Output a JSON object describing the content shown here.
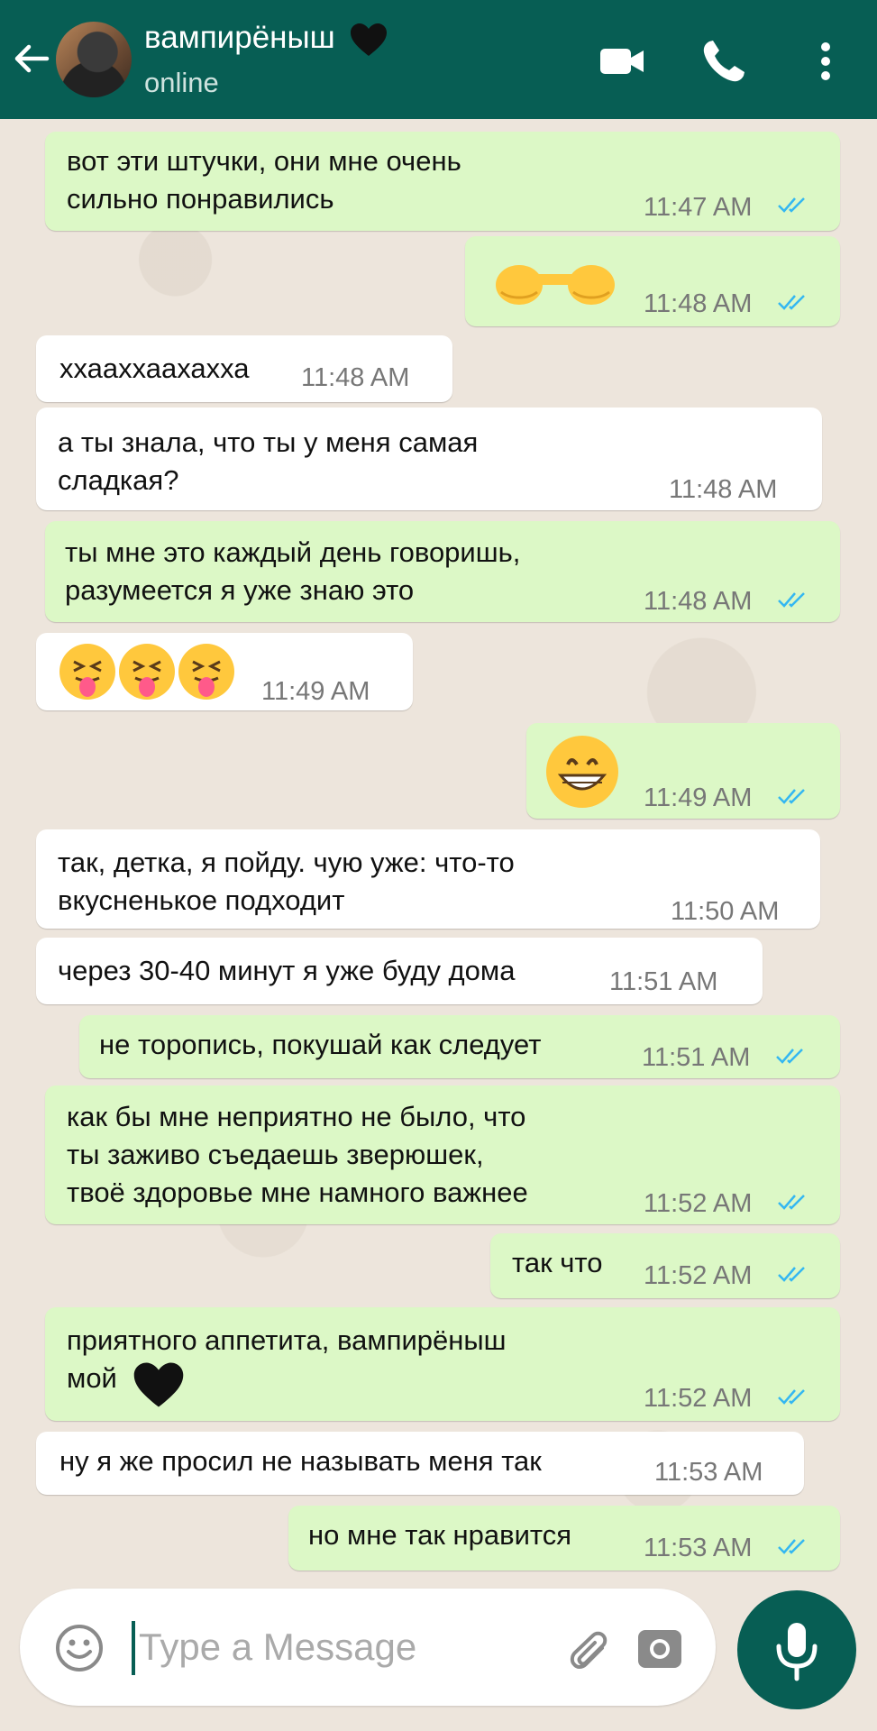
{
  "header": {
    "contact_name": "вампирёныш",
    "status": "online",
    "icons": [
      "back-arrow-icon",
      "video-call-icon",
      "phone-icon",
      "more-options-icon"
    ]
  },
  "messages": [
    {
      "dir": "out",
      "text": "вот эти штучки, они мне очень\nсильно понравились",
      "time": "11:47 AM",
      "read": true
    },
    {
      "dir": "out",
      "emoji": "🫸🫷",
      "text": "",
      "time": "11:48 AM",
      "read": true
    },
    {
      "dir": "in",
      "text": "ххааххаахахха",
      "time": "11:48 AM"
    },
    {
      "dir": "in",
      "text": "а ты знала, что ты у меня самая\nсладкая?",
      "time": "11:48 AM"
    },
    {
      "dir": "out",
      "text": "ты мне это каждый день говоришь,\nразумеется я уже знаю это",
      "time": "11:48 AM",
      "read": true
    },
    {
      "dir": "in",
      "emoji": "😝😝😝",
      "text": "",
      "time": "11:49 AM"
    },
    {
      "dir": "out",
      "emoji": "😁",
      "text": "",
      "time": "11:49 AM",
      "read": true
    },
    {
      "dir": "in",
      "text": "так, детка, я пойду. чую уже: что-то\nвкусненькое подходит",
      "time": "11:50 AM"
    },
    {
      "dir": "in",
      "text": "через 30-40 минут я уже буду дома",
      "time": "11:51 AM"
    },
    {
      "dir": "out",
      "text": "не торопись, покушай как следует",
      "time": "11:51 AM",
      "read": true
    },
    {
      "dir": "out",
      "text": "как бы мне неприятно не было, что\nты заживо съедаешь зверюшек,\nтвоё здоровье мне намного важнее",
      "time": "11:52 AM",
      "read": true
    },
    {
      "dir": "out",
      "text": "так что",
      "time": "11:52 AM",
      "read": true
    },
    {
      "dir": "out",
      "text": "приятного аппетита, вампирёныш\nмой",
      "time": "11:52 AM",
      "read": true
    },
    {
      "dir": "in",
      "text": "ну я же просил не называть меня так",
      "time": "11:53 AM"
    },
    {
      "dir": "out",
      "text": "но мне так нравится",
      "time": "11:53 AM",
      "read": true
    }
  ],
  "input": {
    "placeholder": "Type a Message"
  },
  "colors": {
    "header": "#075e54",
    "outgoing_bubble": "#dcf8c6",
    "incoming_bubble": "#ffffff",
    "read_ticks": "#34b7f1",
    "background": "#ece5dd"
  }
}
